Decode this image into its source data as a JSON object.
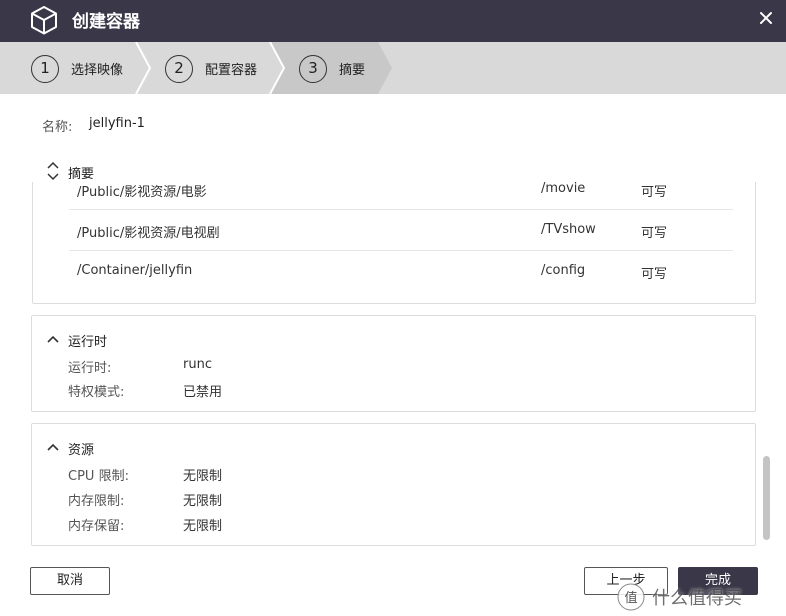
{
  "window": {
    "title": "创建容器"
  },
  "steps": [
    {
      "num": "1",
      "label": "选择映像"
    },
    {
      "num": "2",
      "label": "配置容器"
    },
    {
      "num": "3",
      "label": "摘要"
    }
  ],
  "name": {
    "label": "名称:",
    "value": "jellyfin-1"
  },
  "summary": {
    "label": "摘要",
    "volumes": [
      {
        "host": "/Public/影视资源/电影",
        "container": "/movie",
        "mode": "可写"
      },
      {
        "host": "/Public/影视资源/电视剧",
        "container": "/TVshow",
        "mode": "可写"
      },
      {
        "host": "/Container/jellyfin",
        "container": "/config",
        "mode": "可写"
      }
    ]
  },
  "runtime": {
    "label": "运行时",
    "items": [
      {
        "key": "运行时:",
        "value": "runc"
      },
      {
        "key": "特权模式:",
        "value": "已禁用"
      }
    ]
  },
  "resources": {
    "label": "资源",
    "items": [
      {
        "key": "CPU 限制:",
        "value": "无限制"
      },
      {
        "key": "内存限制:",
        "value": "无限制"
      },
      {
        "key": "内存保留:",
        "value": "无限制"
      }
    ]
  },
  "buttons": {
    "cancel": "取消",
    "prev": "上一步",
    "finish": "完成"
  },
  "watermark": {
    "text": "什么值得买"
  },
  "colors": {
    "titlebar": "#3a3848",
    "stepper": "#d9d9d9",
    "primary": "#3a3848"
  }
}
